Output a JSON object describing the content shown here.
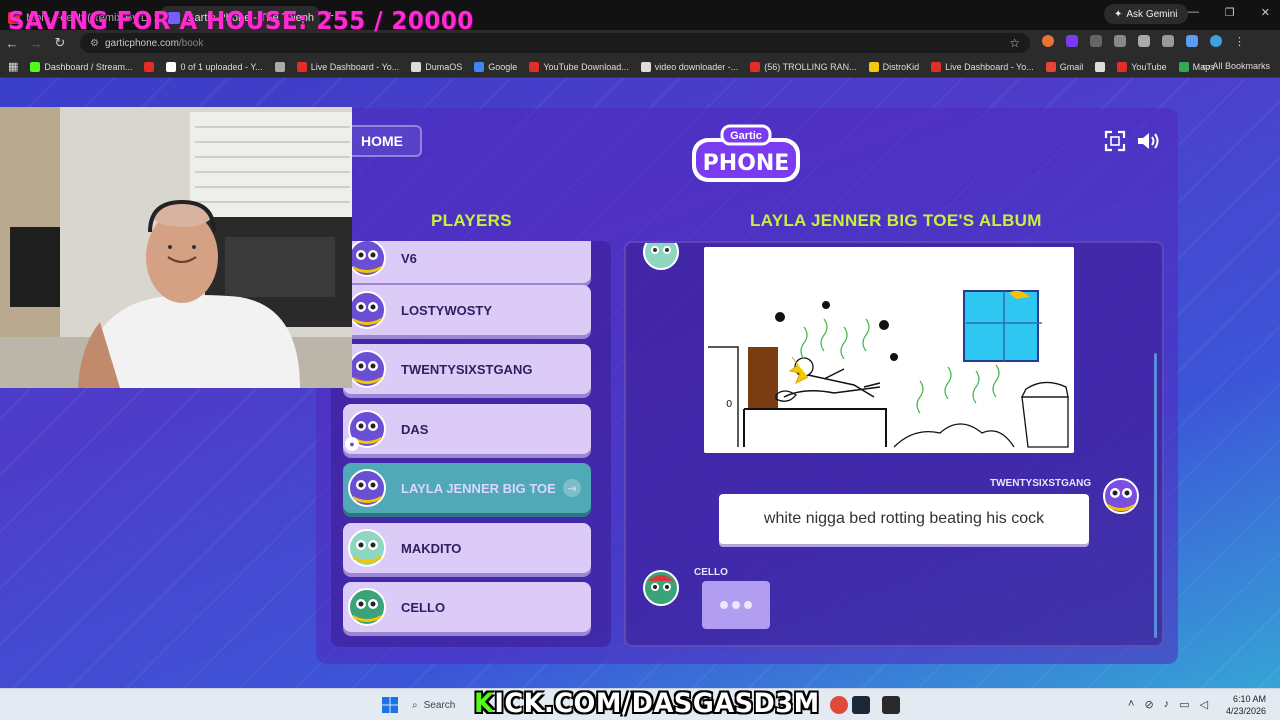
{
  "overlay": {
    "title": "SAVING FOR A HOUSE: 255 / 20000",
    "kick_prefix": "K",
    "kick_rest": "ICK.COM/DASGASD3M"
  },
  "browser": {
    "tabs": [
      {
        "title": "Moi - Feel It (Remix By L",
        "active": false,
        "favicon_color": "#e52d27"
      },
      {
        "title": "Gartic Phone - The Teleph",
        "active": true,
        "favicon_color": "#7a5cff"
      }
    ],
    "ask_gemini": "Ask Gemini",
    "url_domain": "garticphone.com",
    "url_path": "/book",
    "bookmarks": [
      {
        "label": "Dashboard / Stream...",
        "color": "#53fc18"
      },
      {
        "label": "",
        "color": "#e52d27"
      },
      {
        "label": "0 of 1 uploaded - Y...",
        "color": "#ffffff"
      },
      {
        "label": "",
        "color": "#aaaaaa"
      },
      {
        "label": "Live Dashboard - Yo...",
        "color": "#e52d27"
      },
      {
        "label": "DumaOS",
        "color": "#dddddd"
      },
      {
        "label": "Google",
        "color": "#4285f4"
      },
      {
        "label": "YouTube Download...",
        "color": "#e52d27"
      },
      {
        "label": "video downloader -...",
        "color": "#dddddd"
      },
      {
        "label": "(56) TROLLING RAN...",
        "color": "#e52d27"
      },
      {
        "label": "DistroKid",
        "color": "#f2c811"
      },
      {
        "label": "Live Dashboard - Yo...",
        "color": "#e52d27"
      },
      {
        "label": "Gmail",
        "color": "#ea4335"
      },
      {
        "label": "",
        "color": "#dddddd"
      },
      {
        "label": "YouTube",
        "color": "#e52d27"
      },
      {
        "label": "Maps",
        "color": "#34a853"
      }
    ],
    "all_bookmarks": "All Bookmarks"
  },
  "game": {
    "home_label": "HOME",
    "logo_top": "Gartic",
    "logo_bottom": "PHONE",
    "players_title": "PLAYERS",
    "album_title": "LAYLA JENNER BIG TOE'S ALBUM",
    "players": [
      {
        "name": "V6",
        "avatar_color": "#6a4fd4",
        "highlight": false,
        "host": false
      },
      {
        "name": "LOSTYWOSTY",
        "avatar_color": "#6a4fd4",
        "highlight": false,
        "host": false
      },
      {
        "name": "TWENTYSIXSTGANG",
        "avatar_color": "#6a4fd4",
        "highlight": false,
        "host": false
      },
      {
        "name": "DAS",
        "avatar_color": "#6a4fd4",
        "highlight": false,
        "host": true
      },
      {
        "name": "LAYLA JENNER BIG TOE",
        "avatar_color": "#6a4fd4",
        "highlight": true,
        "host": false
      },
      {
        "name": "MAKDITO",
        "avatar_color": "#8fd6c0",
        "highlight": false,
        "host": false
      },
      {
        "name": "CELLO",
        "avatar_color": "#3aa37a",
        "highlight": false,
        "host": false
      }
    ],
    "caption_author": "TWENTYSIXSTGANG",
    "caption_text": "white nigga bed rotting beating his cock",
    "typing_author": "CELLO"
  },
  "taskbar": {
    "search_label": "Search",
    "time": "6:10 AM",
    "date": "4/23/2026"
  },
  "colors": {
    "accent_green": "#c8f040",
    "overlay_pink": "#ff2bd1",
    "kick_green": "#53fc18"
  }
}
